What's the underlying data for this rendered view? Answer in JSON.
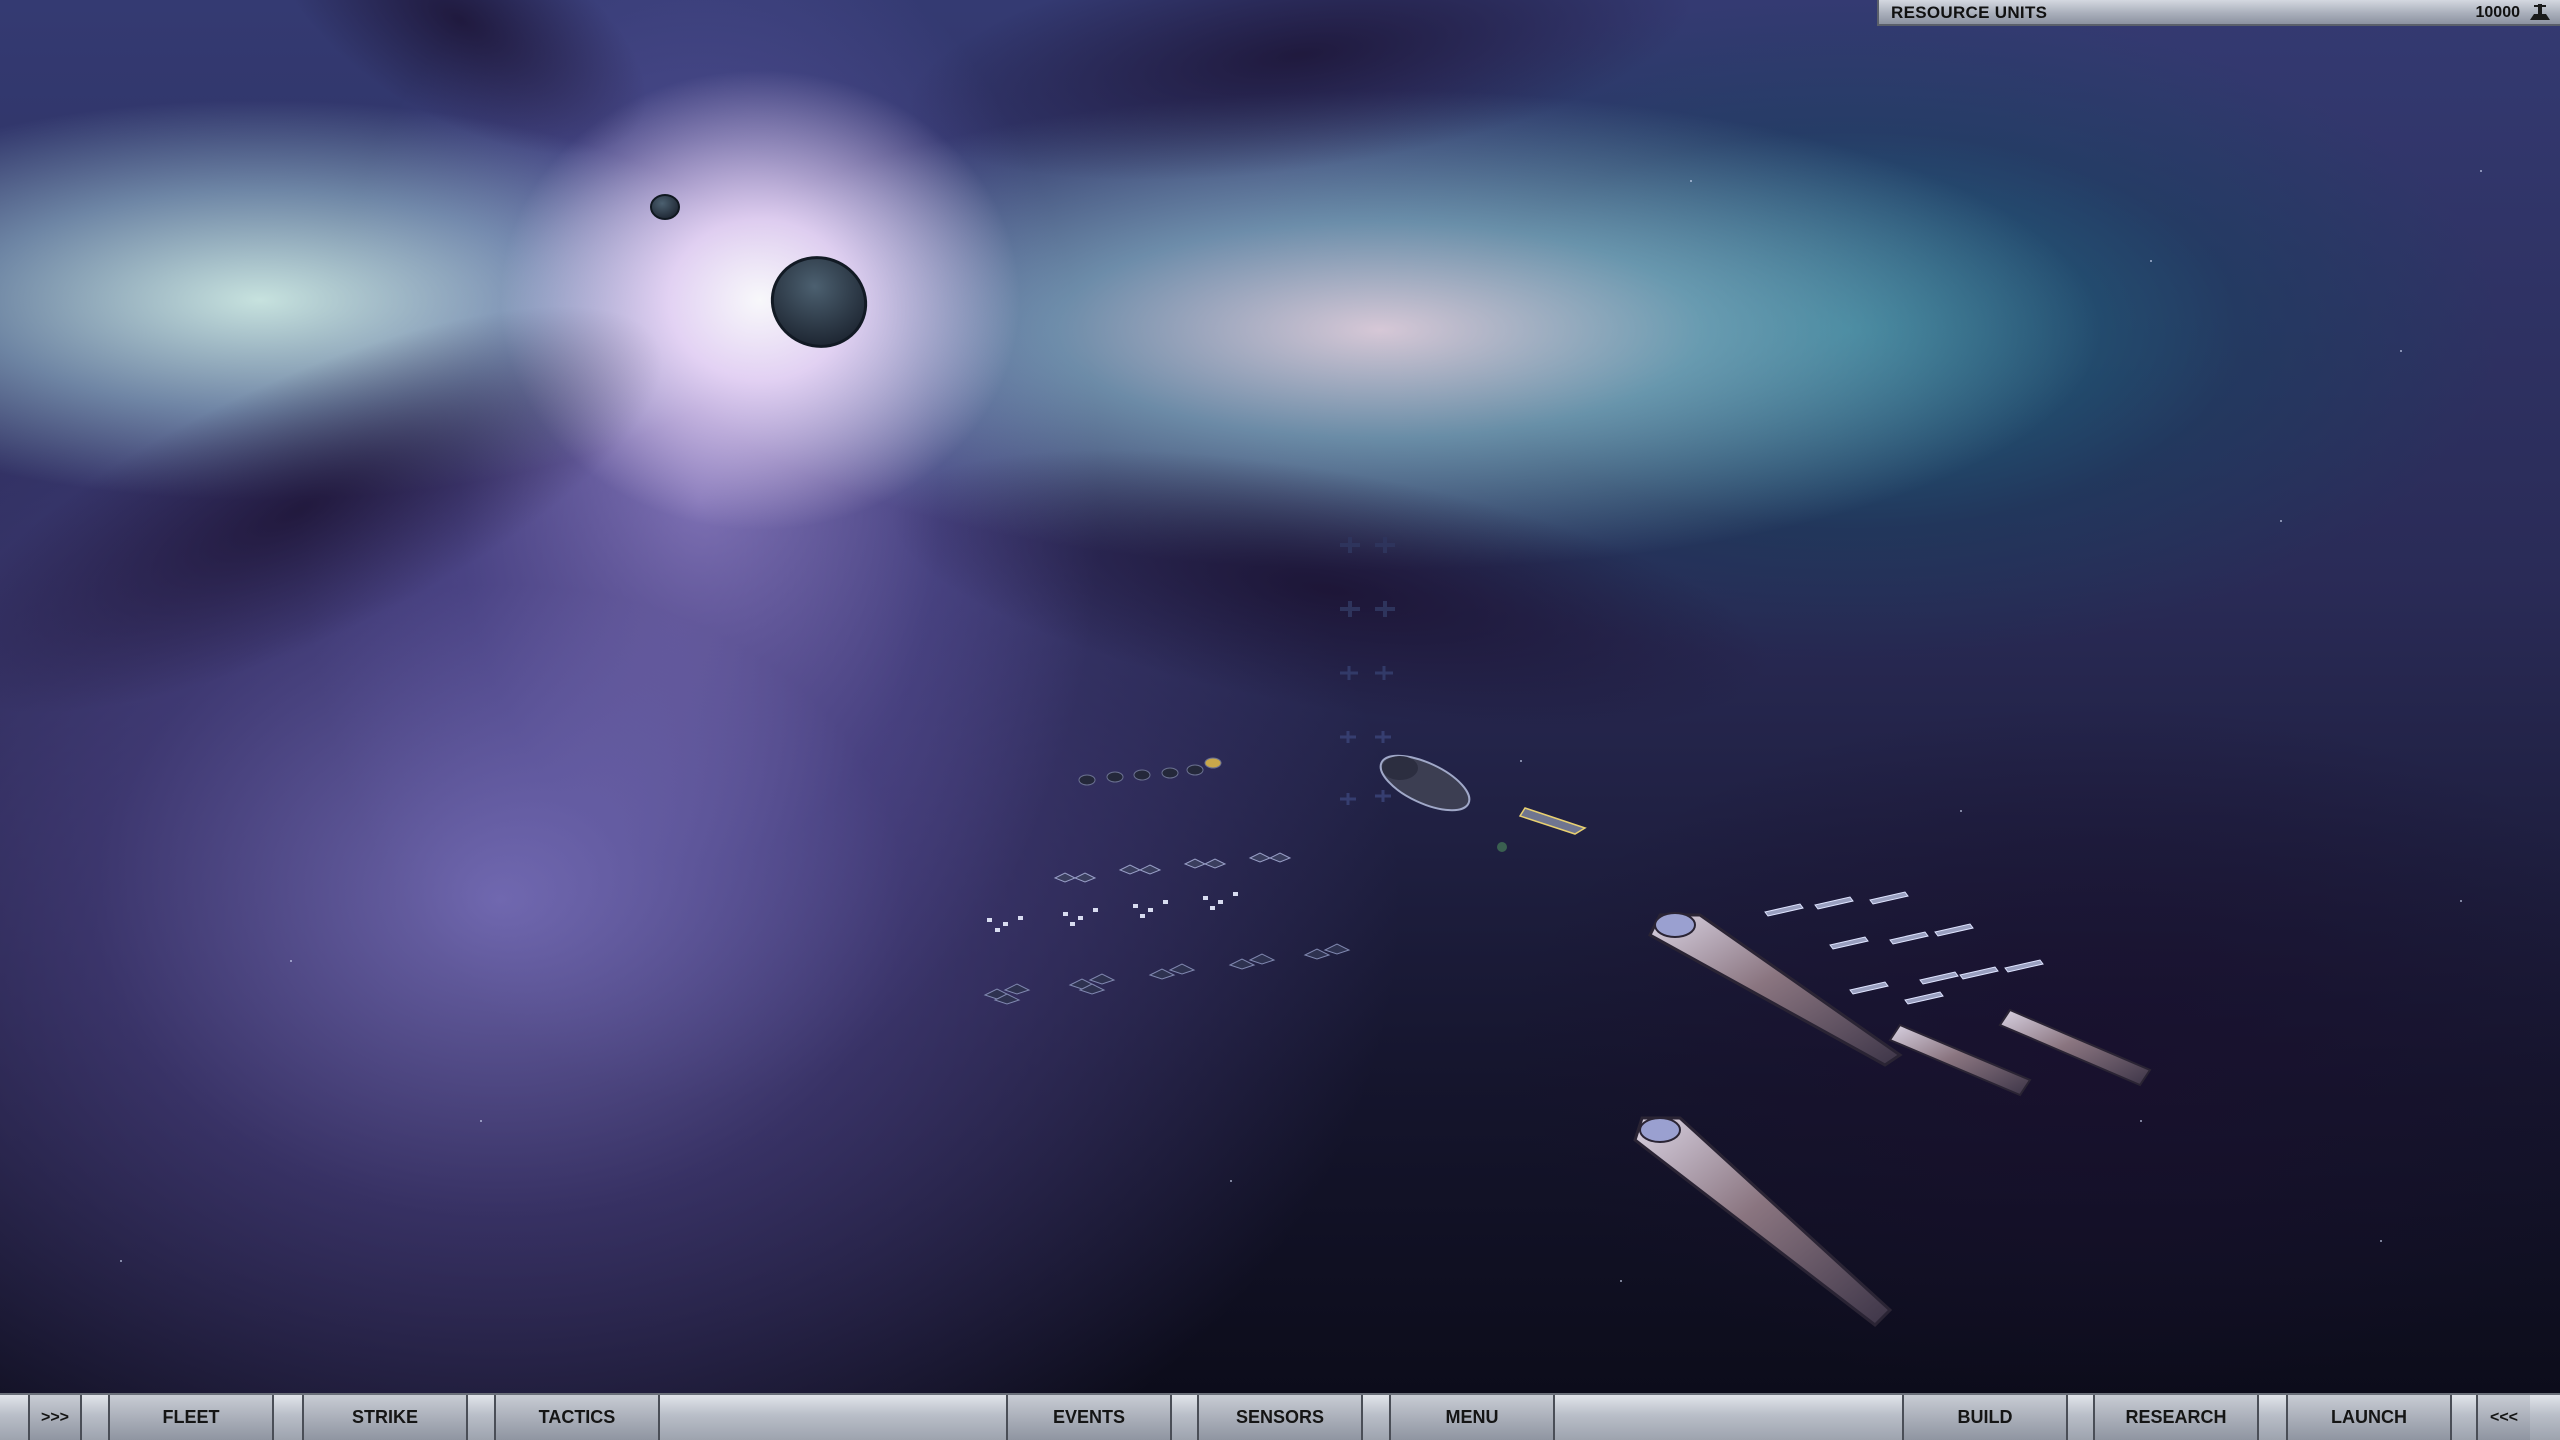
{
  "hud_top": {
    "label": "RESOURCE UNITS",
    "value": "10000",
    "icon": "resource-icon"
  },
  "hud_bottom": {
    "left_toggle": ">>>",
    "right_toggle": "<<<",
    "buttons": {
      "fleet": "FLEET",
      "strike": "STRIKE",
      "tactics": "TACTICS",
      "events": "EVENTS",
      "sensors": "SENSORS",
      "menu": "MENU",
      "build": "BUILD",
      "research": "RESEARCH",
      "launch": "LAUNCH"
    }
  },
  "colors": {
    "hud_bg": "#b9bec8",
    "hud_text": "#151515",
    "space_dark": "#0b0b18",
    "nebula_teal": "#1e7890",
    "nebula_violet": "#8278c8",
    "hull": "#8a7580"
  }
}
